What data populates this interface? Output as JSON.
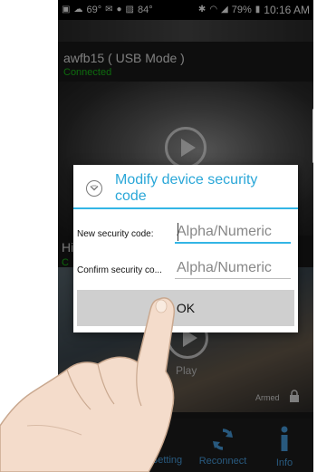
{
  "status_bar": {
    "temp1": "69°",
    "temp2": "84°",
    "battery": "79%",
    "time": "10:16 AM"
  },
  "camera1": {
    "name": "awfb15 ( USB Mode )",
    "status": "Connected"
  },
  "camera2": {
    "name": "Hi",
    "status": "C"
  },
  "video2": {
    "play_label": "Play",
    "armed_label": "Armed"
  },
  "bottom_tabs": [
    {
      "label": "Setting",
      "icon": "gear-icon"
    },
    {
      "label": "Reconnect",
      "icon": "reconnect-icon"
    },
    {
      "label": "Info",
      "icon": "info-icon"
    }
  ],
  "dialog": {
    "title": "Modify device security code",
    "new_code_label": "New security code:",
    "new_code_placeholder": "Alpha/Numeric",
    "new_code_value": "",
    "confirm_code_label": "Confirm security co...",
    "confirm_code_placeholder": "Alpha/Numeric",
    "confirm_code_value": "",
    "ok_label": "OK"
  },
  "colors": {
    "accent": "#33b5e5",
    "connected": "#19c219",
    "tab_blue": "#4aa3e6"
  }
}
